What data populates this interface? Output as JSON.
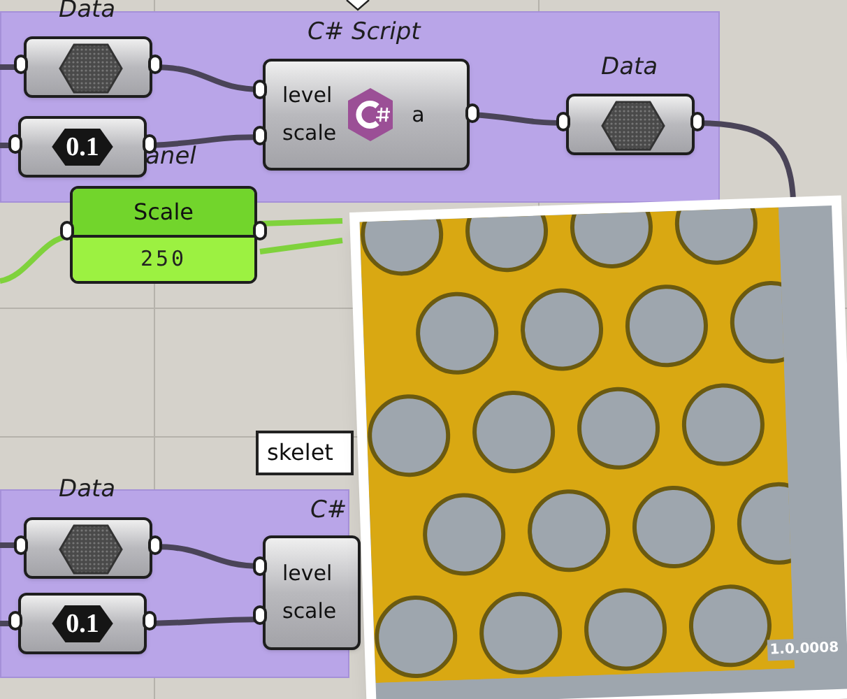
{
  "top_group": {
    "title": "C# Script",
    "input_label": "Data",
    "output_label": "Data",
    "panel_label": "anel",
    "number": "0.1",
    "script": {
      "inputs": [
        "level",
        "scale"
      ],
      "output": "a"
    }
  },
  "slider": {
    "name": "Scale",
    "value": "250"
  },
  "tooltip": "skelet",
  "bottom_group": {
    "title": "C#",
    "input_label": "Data",
    "number": "0.1",
    "script": {
      "inputs": [
        "level",
        "scale"
      ]
    }
  },
  "viewport": {
    "version": "1.0.0008"
  }
}
